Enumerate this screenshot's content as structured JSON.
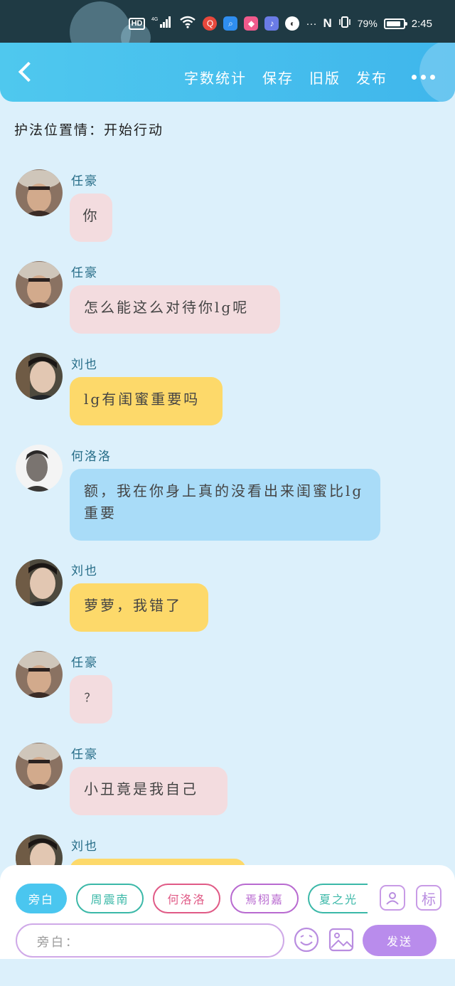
{
  "status_bar": {
    "hd": "HD",
    "network": "4G",
    "battery_percent": "79%",
    "time": "2:45",
    "overflow": "···"
  },
  "header": {
    "actions": [
      "字数统计",
      "保存",
      "旧版",
      "发布"
    ],
    "icons": [
      "back-arrow",
      "more-dots"
    ]
  },
  "subtitle": "护法位置情：开始行动",
  "messages": [
    {
      "name": "任豪",
      "text": "你",
      "color": "pink"
    },
    {
      "name": "任豪",
      "text": "怎么能这么对待你lg呢",
      "color": "pink"
    },
    {
      "name": "刘也",
      "text": "lg有闺蜜重要吗",
      "color": "yellow"
    },
    {
      "name": "何洛洛",
      "text": "额，我在你身上真的没看出来闺蜜比lg重要",
      "color": "blue"
    },
    {
      "name": "刘也",
      "text": "萝萝，我错了",
      "color": "yellow"
    },
    {
      "name": "任豪",
      "text": "？",
      "color": "pink"
    },
    {
      "name": "任豪",
      "text": "小丑竟是我自己",
      "color": "pink"
    },
    {
      "name": "刘也",
      "text": "",
      "color": "yellow"
    }
  ],
  "role_chips": [
    {
      "label": "旁白",
      "active": true,
      "color": "#4ac6ef"
    },
    {
      "label": "周震南",
      "active": false,
      "color": "#3bb8a8"
    },
    {
      "label": "何洛洛",
      "active": false,
      "color": "#e05a86"
    },
    {
      "label": "焉栩嘉",
      "active": false,
      "color": "#b86ad0"
    },
    {
      "label": "夏之光",
      "active": false,
      "color": "#3bb8a8"
    }
  ],
  "side_buttons": {
    "role_icon": "person-card-icon",
    "tag_label": "标"
  },
  "input": {
    "placeholder": "旁白："
  },
  "send_label": "发送",
  "colors": {
    "header": "#45bfee",
    "background": "#dcf0fb",
    "pink_bubble": "#f3dcdf",
    "yellow_bubble": "#fdd96a",
    "blue_bubble": "#a9dcf8",
    "accent_purple": "#b98cec",
    "name_text": "#246b86"
  }
}
